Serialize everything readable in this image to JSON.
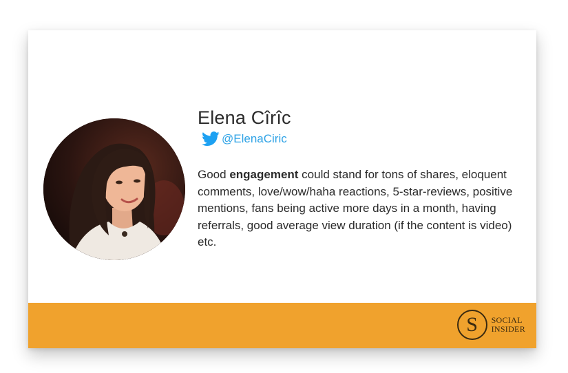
{
  "profile": {
    "name": "Elena Cîrîc",
    "handle": "@ElenaCiric",
    "avatar_icon": "person-photo"
  },
  "quote": {
    "before": "Good ",
    "bold": "engagement",
    "after": " could stand for tons of shares, eloquent comments, love/wow/haha reactions, 5-star-reviews, positive mentions, fans being active more days in a month, having referrals, good average view duration (if the content is video) etc."
  },
  "brand": {
    "logo_letter": "S",
    "line1": "SOCIAL",
    "line2": "INSIDER"
  },
  "colors": {
    "band": "#f0a22d",
    "handle": "#2fa3e6",
    "twitter": "#1da1f2",
    "text": "#2b2b2b"
  }
}
